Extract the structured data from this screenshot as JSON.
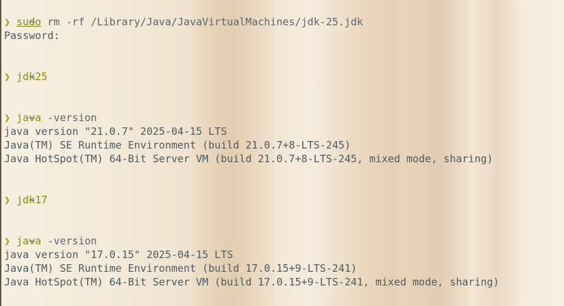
{
  "terminal": {
    "blocks": [
      {
        "tilde": "~",
        "prompt": "❯",
        "command": "sudo",
        "args": " rm -rf /Library/Java/JavaVirtualMachines/jdk-25.jdk",
        "output": [
          "Password:"
        ]
      },
      {
        "tilde": "~",
        "prompt": "❯",
        "command": "jdk25",
        "args": "",
        "output": []
      },
      {
        "tilde": "~",
        "prompt": "❯",
        "command": "java",
        "args": " -version",
        "output": [
          "java version \"21.0.7\" 2025-04-15 LTS",
          "Java(TM) SE Runtime Environment (build 21.0.7+8-LTS-245)",
          "Java HotSpot(TM) 64-Bit Server VM (build 21.0.7+8-LTS-245, mixed mode, sharing)"
        ]
      },
      {
        "tilde": "~",
        "prompt": "❯",
        "command": "jdk17",
        "args": "",
        "output": []
      },
      {
        "tilde": "~",
        "prompt": "❯",
        "command": "java",
        "args": " -version",
        "output": [
          "java version \"17.0.15\" 2025-04-15 LTS",
          "Java(TM) SE Runtime Environment (build 17.0.15+9-LTS-241)",
          "Java HotSpot(TM) 64-Bit Server VM (build 17.0.15+9-LTS-241, mixed mode, sharing)"
        ]
      }
    ]
  }
}
